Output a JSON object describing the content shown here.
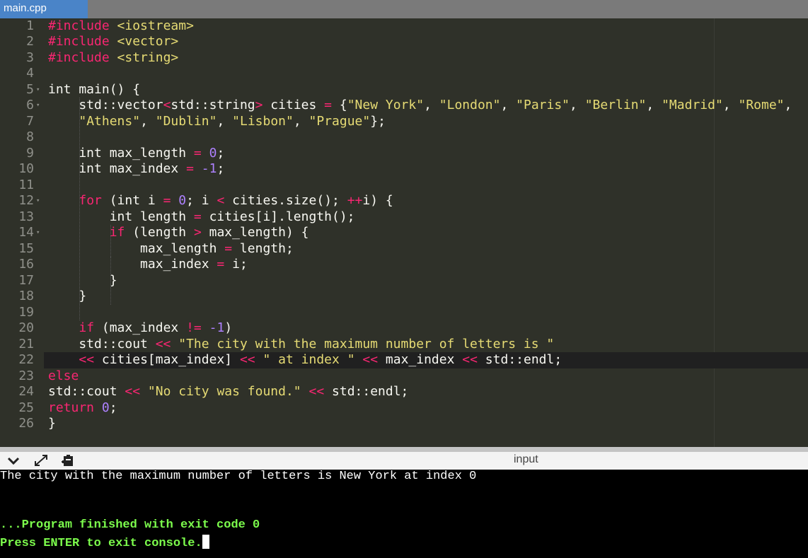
{
  "tab": {
    "filename": "main.cpp"
  },
  "editor": {
    "lines": [
      {
        "n": "1",
        "fold": false,
        "toks": [
          [
            "k",
            "#include"
          ],
          [
            "t",
            " "
          ],
          [
            "s",
            "<iostream>"
          ]
        ]
      },
      {
        "n": "2",
        "fold": false,
        "toks": [
          [
            "k",
            "#include"
          ],
          [
            "t",
            " "
          ],
          [
            "s",
            "<vector>"
          ]
        ]
      },
      {
        "n": "3",
        "fold": false,
        "toks": [
          [
            "k",
            "#include"
          ],
          [
            "t",
            " "
          ],
          [
            "s",
            "<string>"
          ]
        ]
      },
      {
        "n": "4",
        "fold": false,
        "toks": []
      },
      {
        "n": "5",
        "fold": true,
        "toks": [
          [
            "t",
            "int main() {"
          ]
        ]
      },
      {
        "n": "6",
        "fold": true,
        "toks": [
          [
            "t",
            "    std::vector"
          ],
          [
            "o",
            "<"
          ],
          [
            "t",
            "std::string"
          ],
          [
            "o",
            ">"
          ],
          [
            "t",
            " cities "
          ],
          [
            "o",
            "="
          ],
          [
            "t",
            " {"
          ],
          [
            "s",
            "\"New York\""
          ],
          [
            "t",
            ", "
          ],
          [
            "s",
            "\"London\""
          ],
          [
            "t",
            ", "
          ],
          [
            "s",
            "\"Paris\""
          ],
          [
            "t",
            ", "
          ],
          [
            "s",
            "\"Berlin\""
          ],
          [
            "t",
            ", "
          ],
          [
            "s",
            "\"Madrid\""
          ],
          [
            "t",
            ", "
          ],
          [
            "s",
            "\"Rome\""
          ],
          [
            "t",
            ","
          ]
        ]
      },
      {
        "n": "7",
        "fold": false,
        "toks": [
          [
            "t",
            "    "
          ],
          [
            "s",
            "\"Athens\""
          ],
          [
            "t",
            ", "
          ],
          [
            "s",
            "\"Dublin\""
          ],
          [
            "t",
            ", "
          ],
          [
            "s",
            "\"Lisbon\""
          ],
          [
            "t",
            ", "
          ],
          [
            "s",
            "\"Prague\""
          ],
          [
            "t",
            "};"
          ]
        ]
      },
      {
        "n": "8",
        "fold": false,
        "toks": []
      },
      {
        "n": "9",
        "fold": false,
        "toks": [
          [
            "t",
            "    int max_length "
          ],
          [
            "o",
            "="
          ],
          [
            "t",
            " "
          ],
          [
            "n",
            "0"
          ],
          [
            "t",
            ";"
          ]
        ]
      },
      {
        "n": "10",
        "fold": false,
        "toks": [
          [
            "t",
            "    int max_index "
          ],
          [
            "o",
            "="
          ],
          [
            "t",
            " "
          ],
          [
            "n",
            "-1"
          ],
          [
            "t",
            ";"
          ]
        ]
      },
      {
        "n": "11",
        "fold": false,
        "toks": []
      },
      {
        "n": "12",
        "fold": true,
        "toks": [
          [
            "t",
            "    "
          ],
          [
            "k",
            "for"
          ],
          [
            "t",
            " (int i "
          ],
          [
            "o",
            "="
          ],
          [
            "t",
            " "
          ],
          [
            "n",
            "0"
          ],
          [
            "t",
            "; i "
          ],
          [
            "o",
            "<"
          ],
          [
            "t",
            " cities.size(); "
          ],
          [
            "o",
            "++"
          ],
          [
            "t",
            "i) {"
          ]
        ]
      },
      {
        "n": "13",
        "fold": false,
        "toks": [
          [
            "t",
            "        int length "
          ],
          [
            "o",
            "="
          ],
          [
            "t",
            " cities[i].length();"
          ]
        ]
      },
      {
        "n": "14",
        "fold": true,
        "toks": [
          [
            "t",
            "        "
          ],
          [
            "k",
            "if"
          ],
          [
            "t",
            " (length "
          ],
          [
            "o",
            ">"
          ],
          [
            "t",
            " max_length) {"
          ]
        ]
      },
      {
        "n": "15",
        "fold": false,
        "toks": [
          [
            "t",
            "            max_length "
          ],
          [
            "o",
            "="
          ],
          [
            "t",
            " length;"
          ]
        ]
      },
      {
        "n": "16",
        "fold": false,
        "toks": [
          [
            "t",
            "            max_index "
          ],
          [
            "o",
            "="
          ],
          [
            "t",
            " i;"
          ]
        ]
      },
      {
        "n": "17",
        "fold": false,
        "toks": [
          [
            "t",
            "        }"
          ]
        ]
      },
      {
        "n": "18",
        "fold": false,
        "toks": [
          [
            "t",
            "    }"
          ]
        ]
      },
      {
        "n": "19",
        "fold": false,
        "toks": []
      },
      {
        "n": "20",
        "fold": false,
        "toks": [
          [
            "t",
            "    "
          ],
          [
            "k",
            "if"
          ],
          [
            "t",
            " (max_index "
          ],
          [
            "o",
            "!="
          ],
          [
            "t",
            " "
          ],
          [
            "n",
            "-1"
          ],
          [
            "t",
            ")"
          ]
        ]
      },
      {
        "n": "21",
        "fold": false,
        "toks": [
          [
            "t",
            "    std::cout "
          ],
          [
            "o",
            "<<"
          ],
          [
            "t",
            " "
          ],
          [
            "s",
            "\"The city with the maximum number of letters is \""
          ]
        ]
      },
      {
        "n": "22",
        "fold": false,
        "active": true,
        "toks": [
          [
            "t",
            "    "
          ],
          [
            "o",
            "<<"
          ],
          [
            "t",
            " cities[max_index] "
          ],
          [
            "o",
            "<<"
          ],
          [
            "t",
            " "
          ],
          [
            "s",
            "\" at index \""
          ],
          [
            "t",
            " "
          ],
          [
            "o",
            "<<"
          ],
          [
            "t",
            " max_index "
          ],
          [
            "o",
            "<<"
          ],
          [
            "t",
            " std::endl;"
          ]
        ]
      },
      {
        "n": "23",
        "fold": false,
        "toks": [
          [
            "k",
            "else"
          ]
        ]
      },
      {
        "n": "24",
        "fold": false,
        "toks": [
          [
            "t",
            "std::cout "
          ],
          [
            "o",
            "<<"
          ],
          [
            "t",
            " "
          ],
          [
            "s",
            "\"No city was found.\""
          ],
          [
            "t",
            " "
          ],
          [
            "o",
            "<<"
          ],
          [
            "t",
            " std::endl;"
          ]
        ]
      },
      {
        "n": "25",
        "fold": false,
        "toks": [
          [
            "k",
            "return"
          ],
          [
            "t",
            " "
          ],
          [
            "n",
            "0"
          ],
          [
            "t",
            ";"
          ]
        ]
      },
      {
        "n": "26",
        "fold": false,
        "toks": [
          [
            "t",
            "}"
          ]
        ]
      }
    ]
  },
  "console_header": {
    "input_label": "input",
    "icons": [
      "chevron-down-icon",
      "expand-icon",
      "clipboard-icon"
    ]
  },
  "console": {
    "output": "The city with the maximum number of letters is New York at index 0",
    "finished": "...Program finished with exit code 0",
    "prompt": "Press ENTER to exit console."
  },
  "colors": {
    "keyword": "#f92672",
    "string": "#e6db74",
    "number": "#ae81ff",
    "text": "#f8f8f2",
    "gutter": "#8f908a",
    "tab": "#4a84c8",
    "console_green": "#7cfc4c"
  }
}
